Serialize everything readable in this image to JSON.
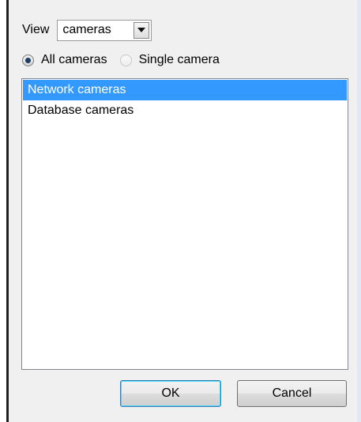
{
  "view": {
    "label": "View",
    "selected": "cameras"
  },
  "scope": {
    "options": [
      {
        "label": "All cameras",
        "checked": true
      },
      {
        "label": "Single camera",
        "checked": false
      }
    ]
  },
  "camera_list": {
    "items": [
      {
        "label": "Network cameras",
        "selected": true
      },
      {
        "label": "Database cameras",
        "selected": false
      }
    ]
  },
  "buttons": {
    "ok_label": "OK",
    "cancel_label": "Cancel"
  },
  "colors": {
    "selection": "#3399ff",
    "dialog_background": "#f0f0f0"
  }
}
